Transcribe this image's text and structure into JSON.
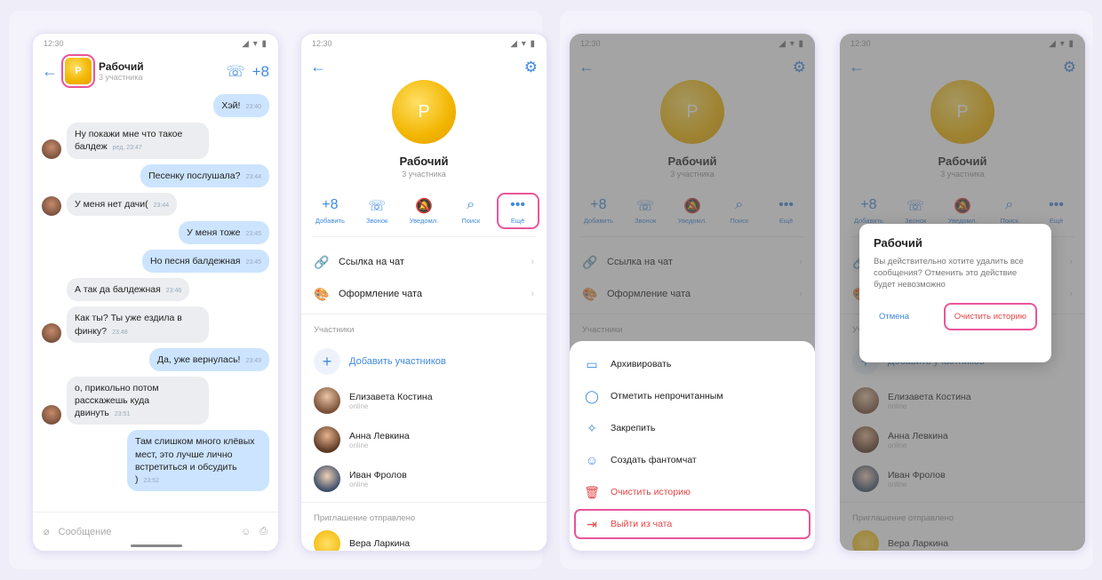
{
  "status": {
    "time": "12:30",
    "icons": "◢ ▾ ▮"
  },
  "chat": {
    "avatar_letter": "Р",
    "title": "Рабочий",
    "subtitle": "3 участника",
    "call_icon": "phone-icon",
    "add_icon": "add-user-icon",
    "messages": [
      {
        "side": "out",
        "text": "Хэй!",
        "time": "23:40",
        "avatar": false
      },
      {
        "side": "in",
        "text": "Ну покажи мне что такое балдеж",
        "time": "ред. 23:47",
        "avatar": true
      },
      {
        "side": "out",
        "text": "Песенку послушала?",
        "time": "23:44",
        "avatar": false
      },
      {
        "side": "in",
        "text": "У меня нет дачи(",
        "time": "23:44",
        "avatar": true
      },
      {
        "side": "out",
        "text": "У меня тоже",
        "time": "23:45",
        "avatar": false
      },
      {
        "side": "out",
        "text": "Но песня балдежная",
        "time": "23:45",
        "avatar": false
      },
      {
        "side": "in",
        "text": "А так да балдежная",
        "time": "23:46",
        "avatar": false
      },
      {
        "side": "in",
        "text": "Как ты? Ты уже ездила в финку?",
        "time": "23:48",
        "avatar": true
      },
      {
        "side": "out",
        "text": "Да, уже вернулась!",
        "time": "23:49",
        "avatar": false
      },
      {
        "side": "in",
        "text": "о, прикольно потом расскажешь куда двинуть",
        "time": "23:51",
        "avatar": true
      },
      {
        "side": "out",
        "text": "Там слишком много клёвых мест, это лучше лично встретиться и обсудить )",
        "time": "23:52",
        "avatar": false
      }
    ],
    "input_placeholder": "Сообщение"
  },
  "profile": {
    "avatar_letter": "Р",
    "name": "Рабочий",
    "count": "3 участника",
    "actions": [
      {
        "icon": "+8",
        "label": "Добавить"
      },
      {
        "icon": "☏",
        "label": "Звонок"
      },
      {
        "icon": "🔕",
        "label": "Уведомл."
      },
      {
        "icon": "⌕",
        "label": "Поиск"
      },
      {
        "icon": "•••",
        "label": "Ещё"
      }
    ],
    "link_label": "Ссылка на чат",
    "design_label": "Оформление чата",
    "members_header": "Участники",
    "add_members": "Добавить участников",
    "members": [
      {
        "name": "Елизавета Костина",
        "status": "online"
      },
      {
        "name": "Анна Левкина",
        "status": "online"
      },
      {
        "name": "Иван Фролов",
        "status": "online"
      }
    ],
    "invites_header": "Приглашение отправлено",
    "invitee": "Вера Ларкина"
  },
  "sheet": {
    "items": [
      {
        "icon": "▭",
        "label": "Архивировать"
      },
      {
        "icon": "◯",
        "label": "Отметить непрочитанным"
      },
      {
        "icon": "✧",
        "label": "Закрепить"
      },
      {
        "icon": "☺",
        "label": "Создать фантомчат"
      },
      {
        "icon": "🗑",
        "label": "Очистить историю"
      },
      {
        "icon": "⇥",
        "label": "Выйти из чата"
      }
    ]
  },
  "dialog": {
    "title": "Рабочий",
    "text": "Вы действительно хотите удалить все сообщения? Отменить это действие будет невозможно",
    "cancel": "Отмена",
    "confirm": "Очистить историю"
  },
  "colors": {
    "accent": "#3f8ae0",
    "highlight": "#e9559b",
    "danger": "#e64646"
  }
}
